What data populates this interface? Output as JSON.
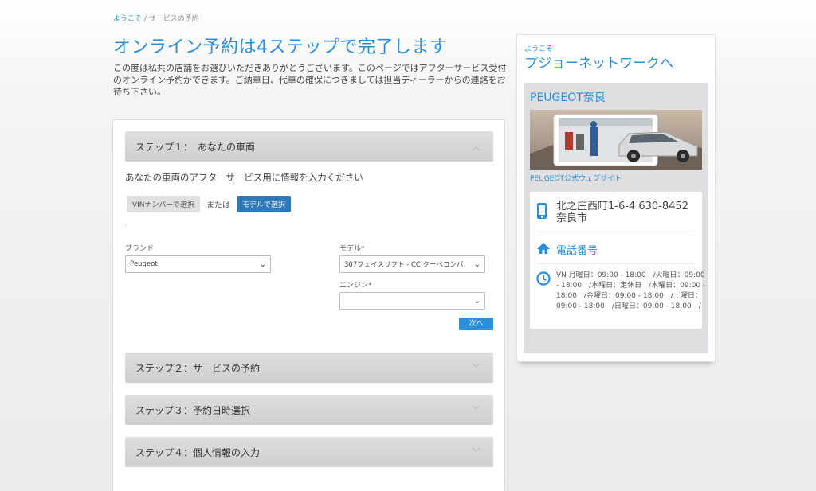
{
  "breadcrumb": {
    "home": "ようこそ",
    "separator": " / ",
    "current": "サービスの予約"
  },
  "page": {
    "title": "オンライン予約は4ステップで完了します",
    "intro": "この度は私共の店舗をお選びいただきありがとうございます。このページではアフターサービス受付のオンライン予約ができます。ご納車日、代車の確保につきましては担当ディーラーからの連絡をお待ち下さい。"
  },
  "steps": {
    "step1": "ステップ１：　あなたの車両",
    "step2": "ステップ２：サービスの予約",
    "step3": "ステップ３：予約日時選択",
    "step4": "ステップ４：個人情報の入力"
  },
  "vehicle": {
    "subtitle": "あなたの車両のアフターサービス用に情報を入力ください",
    "vin_button": "VINナンバーで選択",
    "or_text": "または",
    "model_button": "モデルで選択",
    "dot": "."
  },
  "form": {
    "brand_label": "ブランド",
    "brand_value": "Peugeot",
    "model_label": "モデル*",
    "model_value": "307フェイスリフト - CC クーペコンバ",
    "engine_label": "エンジン*",
    "engine_value": "",
    "next_button": "次へ"
  },
  "sidebar": {
    "welcome_small": "ようこそ",
    "welcome_big": "プジョーネットワークへ",
    "dealer_name": "PEUGEOT奈良",
    "dealer_link": "PEUGEOT公式ウェブサイト",
    "address": "北之庄西町1-6-4 630-8452 奈良市",
    "phone_label": "電話番号",
    "hours": "VN 月曜日：09:00 - 18:00　/火曜日：09:00 - 18:00　/水曜日：定休日　/木曜日：09:00 - 18:00　/金曜日：09:00 - 18:00　/土曜日：09:00 - 18:00　/日曜日：09:00 - 18:00　/"
  },
  "colors": {
    "accent": "#2a8fd8",
    "button_dark": "#2e79b8",
    "step_bar": "#d6d6d6"
  }
}
